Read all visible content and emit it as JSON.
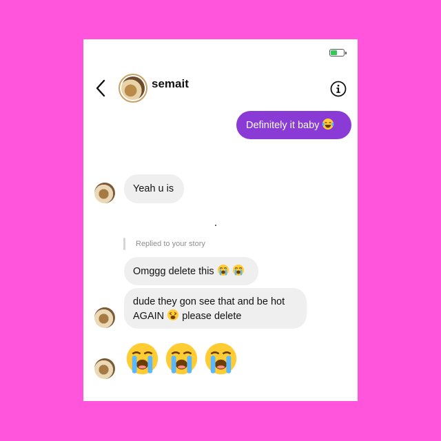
{
  "header": {
    "username": "semait"
  },
  "messages": {
    "sent_1": "Definitely it baby",
    "recv_1": "Yeah u is",
    "reply_label": "Replied to your story",
    "recv_2": "Omggg delete this",
    "recv_3_line1": "dude they gon see that and be hot",
    "recv_3_line2_a": "AGAIN",
    "recv_3_line2_b": "please delete"
  },
  "colors": {
    "background": "#ff55dd",
    "sent_bubble": "#8a3bd6",
    "received_bubble": "#efefef",
    "battery": "#34c759"
  },
  "icons": {
    "back": "chevron-left-icon",
    "info": "info-icon",
    "battery": "battery-charging-icon",
    "emoji_laugh": "tears-of-joy-emoji",
    "emoji_cry": "loudly-crying-emoji",
    "emoji_weary": "weary-face-emoji"
  }
}
